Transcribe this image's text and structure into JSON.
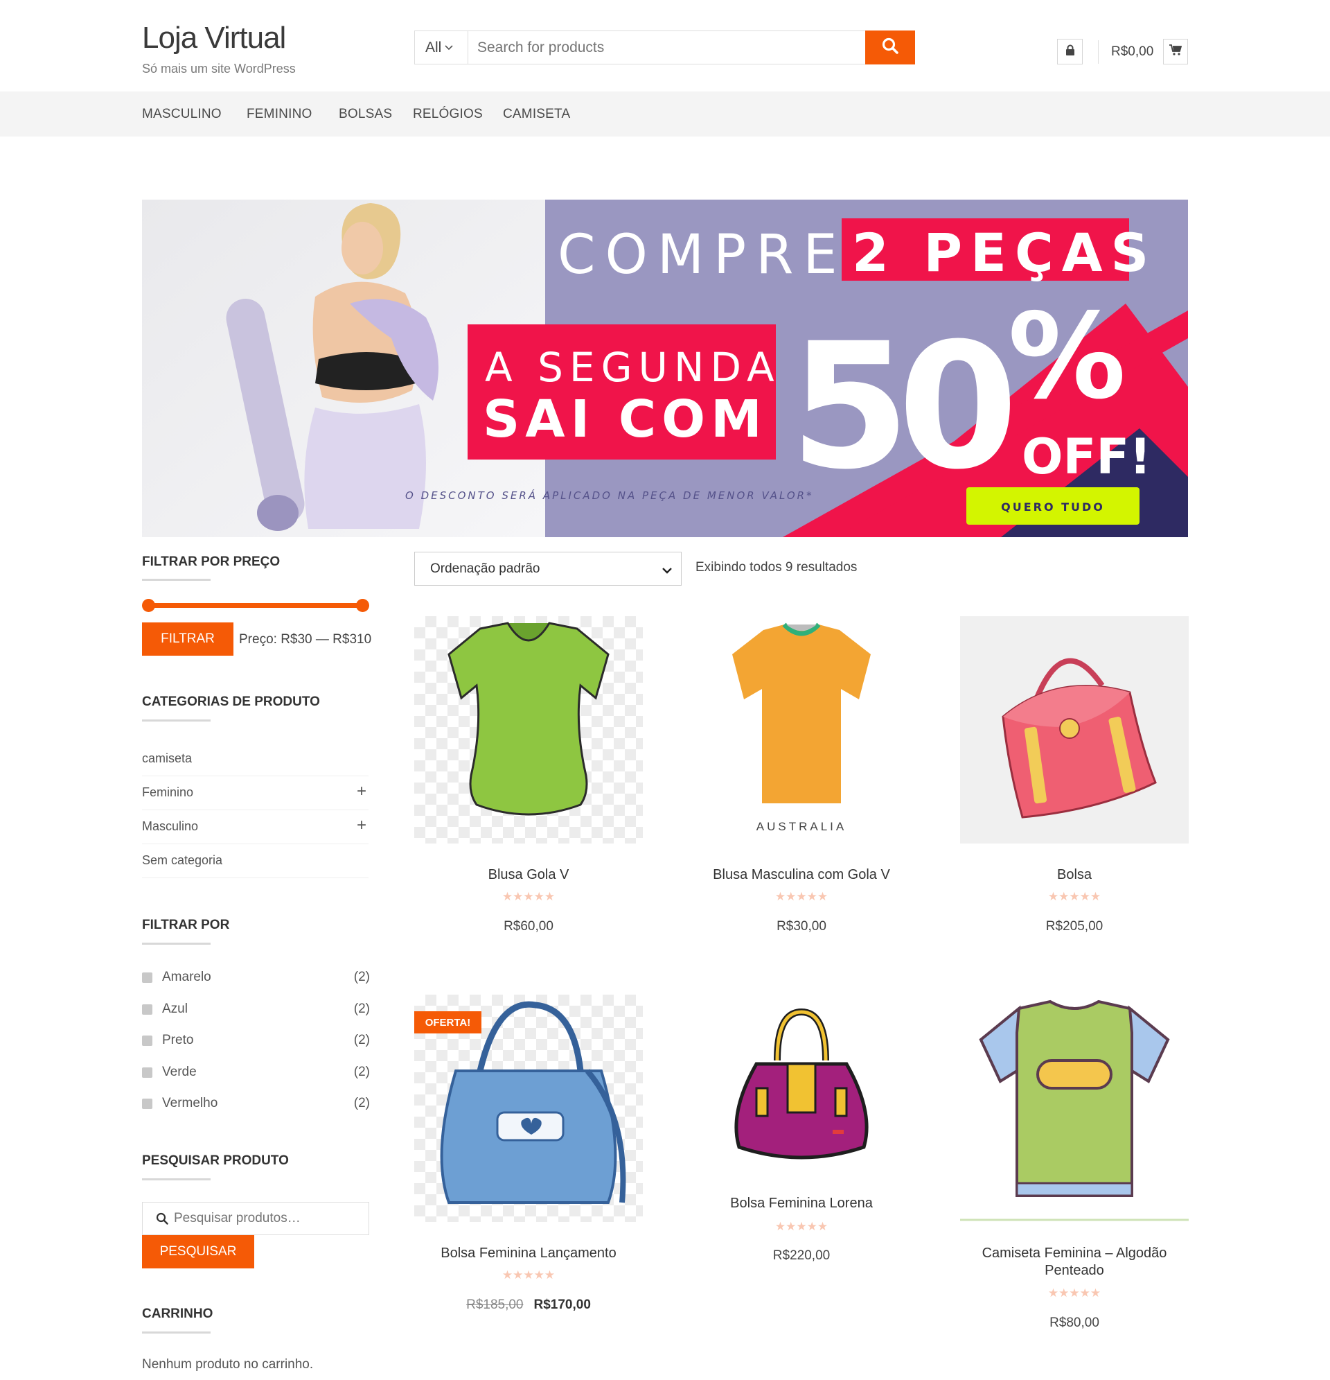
{
  "header": {
    "site_title": "Loja Virtual",
    "tagline": "Só mais um site WordPress",
    "search_category": "All",
    "search_placeholder": "Search for products",
    "cart_total": "R$0,00"
  },
  "nav": {
    "items": [
      "MASCULINO",
      "FEMININO",
      "BOLSAS",
      "RELÓGIOS",
      "CAMISETA"
    ]
  },
  "banner": {
    "line1_a": "COMPRE",
    "line1_b": "2 PEÇAS",
    "line2_a": "A SEGUNDA",
    "line2_b": "SAI COM",
    "big_number": "50",
    "percent": "%",
    "off": "OFF!",
    "disclaimer": "O DESCONTO SERÁ APLICADO NA PEÇA DE MENOR VALOR*",
    "cta": "QUERO TUDO",
    "colors": {
      "lavender": "#9a97c1",
      "red": "#f0144a",
      "navy": "#2e2a62",
      "lime": "#d3f500"
    }
  },
  "sidebar": {
    "price_filter": {
      "title": "FILTRAR POR PREÇO",
      "button": "FILTRAR",
      "range_label": "Preço: R$30 — R$310"
    },
    "categories": {
      "title": "CATEGORIAS DE PRODUTO",
      "items": [
        {
          "label": "camiseta"
        },
        {
          "label": "Feminino"
        },
        {
          "label": "Masculino"
        },
        {
          "label": "Sem categoria"
        }
      ]
    },
    "filter_by": {
      "title": "FILTRAR POR",
      "items": [
        {
          "label": "Amarelo",
          "count": "(2)"
        },
        {
          "label": "Azul",
          "count": "(2)"
        },
        {
          "label": "Preto",
          "count": "(2)"
        },
        {
          "label": "Verde",
          "count": "(2)"
        },
        {
          "label": "Vermelho",
          "count": "(2)"
        }
      ]
    },
    "product_search": {
      "title": "PESQUISAR PRODUTO",
      "placeholder": "Pesquisar produtos…",
      "button": "PESQUISAR"
    },
    "cart": {
      "title": "CARRINHO",
      "empty": "Nenhum produto no carrinho."
    }
  },
  "toolbar": {
    "orderby": "Ordenação padrão",
    "result_count": "Exibindo todos 9 resultados"
  },
  "products": [
    {
      "title": "Blusa Gola V",
      "price": "R$60,00",
      "rating_stars": "★★★★★"
    },
    {
      "title": "Blusa Masculina com Gola V",
      "price": "R$30,00",
      "rating_stars": "★★★★★",
      "shirt_print": "AUSTRALIA"
    },
    {
      "title": "Bolsa",
      "price": "R$205,00",
      "rating_stars": "★★★★★"
    },
    {
      "title": "Bolsa Feminina Lançamento",
      "old_price": "R$185,00",
      "price": "R$170,00",
      "badge": "OFERTA!",
      "rating_stars": "★★★★★"
    },
    {
      "title": "Bolsa Feminina Lorena",
      "price": "R$220,00",
      "rating_stars": "★★★★★"
    },
    {
      "title_line1": "Camiseta Feminina – Algodão",
      "title_line2": "Penteado",
      "price": "R$80,00",
      "rating_stars": "★★★★★"
    }
  ],
  "theme": {
    "accent": "#f55a06"
  }
}
